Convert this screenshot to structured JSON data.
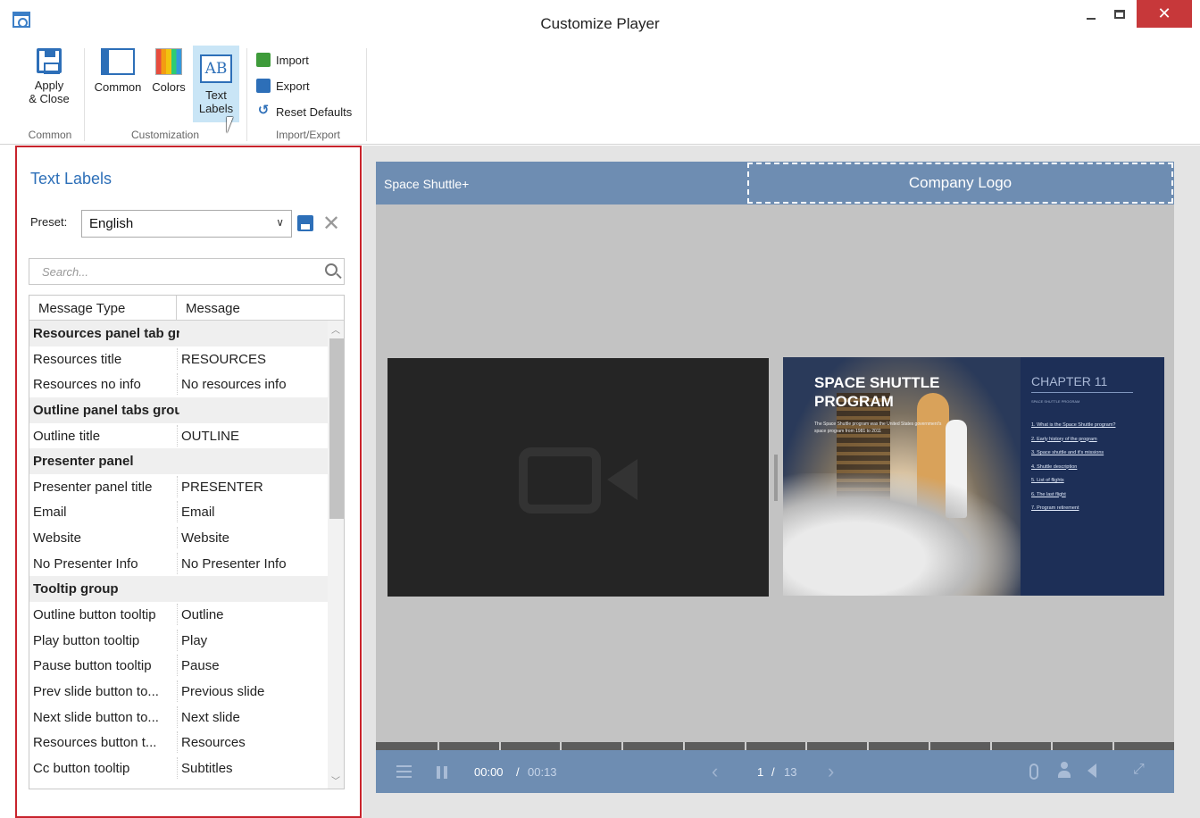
{
  "window": {
    "title": "Customize Player",
    "close_glyph": "✕"
  },
  "ribbon": {
    "apply_close": "Apply\n& Close",
    "apply_line1": "Apply",
    "apply_line2": "& Close",
    "common": "Common",
    "colors": "Colors",
    "text_labels_line1": "Text",
    "text_labels_line2": "Labels",
    "text_icon_glyph": "AB",
    "import": "Import",
    "export": "Export",
    "reset_defaults": "Reset Defaults",
    "groups": {
      "common": "Common",
      "customization": "Customization",
      "import_export": "Import/Export"
    }
  },
  "text_labels_panel": {
    "title": "Text Labels",
    "preset_label": "Preset:",
    "preset_value": "English",
    "search_placeholder": "Search...",
    "columns": [
      "Message Type",
      "Message"
    ],
    "rows": [
      {
        "type": "Resources panel tab groups",
        "message": "",
        "group": true
      },
      {
        "type": "Resources title",
        "message": "RESOURCES",
        "group": false
      },
      {
        "type": "Resources no info",
        "message": "No resources info",
        "group": false
      },
      {
        "type": "Outline panel tabs group",
        "message": "",
        "group": true
      },
      {
        "type": "Outline title",
        "message": "OUTLINE",
        "group": false
      },
      {
        "type": "Presenter panel",
        "message": "",
        "group": true
      },
      {
        "type": "Presenter panel title",
        "message": "PRESENTER",
        "group": false
      },
      {
        "type": "Email",
        "message": "Email",
        "group": false
      },
      {
        "type": "Website",
        "message": "Website",
        "group": false
      },
      {
        "type": "No Presenter Info",
        "message": "No Presenter Info",
        "group": false
      },
      {
        "type": "Tooltip group",
        "message": "",
        "group": true
      },
      {
        "type": "Outline button tooltip",
        "message": "Outline",
        "group": false
      },
      {
        "type": "Play button tooltip",
        "message": "Play",
        "group": false
      },
      {
        "type": "Pause button tooltip",
        "message": "Pause",
        "group": false
      },
      {
        "type": "Prev slide button to...",
        "message": "Previous slide",
        "group": false
      },
      {
        "type": "Next slide button to...",
        "message": "Next slide",
        "group": false
      },
      {
        "type": "Resources  button t...",
        "message": "Resources",
        "group": false
      },
      {
        "type": "Cc button tooltip",
        "message": "Subtitles",
        "group": false
      }
    ]
  },
  "player": {
    "course_title": "Space Shuttle+",
    "company_logo": "Company Logo",
    "slide": {
      "title": "SPACE SHUTTLE PROGRAM",
      "subtitle": "The Space Shuttle program was the United States government's space program from 1981 to 2011",
      "chapter": "CHAPTER 11",
      "chapter_sub": "SPACE SHUTTLE PROGRAM",
      "toc": [
        "1. What is the Space Shuttle program?",
        "2. Early history of the program",
        "3. Space shuttle and it's missions",
        "4. Shuttle description",
        "5. List of flights",
        "6. The last flight",
        "7. Program retirement"
      ]
    },
    "controls": {
      "time_current": "00:00",
      "time_separator": "/",
      "time_total": "00:13",
      "page_current": "1",
      "page_separator": "/",
      "page_total": "13",
      "progress_segments": 13,
      "prev_glyph": "‹",
      "next_glyph": "›",
      "fullscreen_glyph": "⤢"
    }
  },
  "colors": {
    "accent_blue": "#2d6fb8",
    "player_bar": "#6e8db2",
    "highlight_border": "#c8232c",
    "close_red": "#c7383a"
  }
}
